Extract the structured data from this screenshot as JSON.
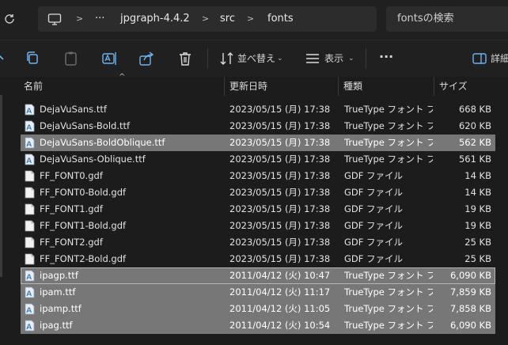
{
  "address": {
    "breadcrumb": [
      "jpgraph-4.4.2",
      "src",
      "fonts"
    ],
    "more": "···",
    "search_placeholder": "fontsの検索"
  },
  "toolbar": {
    "sort_label": "並べ替え",
    "view_label": "表示",
    "more": "···",
    "details_label": "詳細"
  },
  "columns": {
    "name": "名前",
    "date": "更新日時",
    "type": "種類",
    "size": "サイズ"
  },
  "files": [
    {
      "name": "DejaVuSans.ttf",
      "date": "2023/05/15 (月) 17:38",
      "type": "TrueType フォント フ",
      "size": "668 KB",
      "kind": "ttf",
      "selected": false
    },
    {
      "name": "DejaVuSans-Bold.ttf",
      "date": "2023/05/15 (月) 17:38",
      "type": "TrueType フォント フ",
      "size": "620 KB",
      "kind": "ttf",
      "selected": false
    },
    {
      "name": "DejaVuSans-BoldOblique.ttf",
      "date": "2023/05/15 (月) 17:38",
      "type": "TrueType フォント フ",
      "size": "562 KB",
      "kind": "ttf",
      "selected": true
    },
    {
      "name": "DejaVuSans-Oblique.ttf",
      "date": "2023/05/15 (月) 17:38",
      "type": "TrueType フォント フ",
      "size": "561 KB",
      "kind": "ttf",
      "selected": false
    },
    {
      "name": "FF_FONT0.gdf",
      "date": "2023/05/15 (月) 17:38",
      "type": "GDF ファイル",
      "size": "14 KB",
      "kind": "gdf",
      "selected": false
    },
    {
      "name": "FF_FONT0-Bold.gdf",
      "date": "2023/05/15 (月) 17:38",
      "type": "GDF ファイル",
      "size": "14 KB",
      "kind": "gdf",
      "selected": false
    },
    {
      "name": "FF_FONT1.gdf",
      "date": "2023/05/15 (月) 17:38",
      "type": "GDF ファイル",
      "size": "19 KB",
      "kind": "gdf",
      "selected": false
    },
    {
      "name": "FF_FONT1-Bold.gdf",
      "date": "2023/05/15 (月) 17:38",
      "type": "GDF ファイル",
      "size": "19 KB",
      "kind": "gdf",
      "selected": false
    },
    {
      "name": "FF_FONT2.gdf",
      "date": "2023/05/15 (月) 17:38",
      "type": "GDF ファイル",
      "size": "25 KB",
      "kind": "gdf",
      "selected": false
    },
    {
      "name": "FF_FONT2-Bold.gdf",
      "date": "2023/05/15 (月) 17:38",
      "type": "GDF ファイル",
      "size": "25 KB",
      "kind": "gdf",
      "selected": false
    },
    {
      "name": "ipagp.ttf",
      "date": "2011/04/12 (火) 10:47",
      "type": "TrueType フォント フ",
      "size": "6,090 KB",
      "kind": "ttf",
      "selected": true,
      "focused": true
    },
    {
      "name": "ipam.ttf",
      "date": "2011/04/12 (火) 11:17",
      "type": "TrueType フォント フ",
      "size": "7,859 KB",
      "kind": "ttf",
      "selected": true
    },
    {
      "name": "ipamp.ttf",
      "date": "2011/04/12 (火) 11:05",
      "type": "TrueType フォント フ",
      "size": "7,858 KB",
      "kind": "ttf",
      "selected": true
    },
    {
      "name": "ipag.ttf",
      "date": "2011/04/12 (火) 10:54",
      "type": "TrueType フォント フ",
      "size": "6,090 KB",
      "kind": "ttf",
      "selected": true
    }
  ]
}
